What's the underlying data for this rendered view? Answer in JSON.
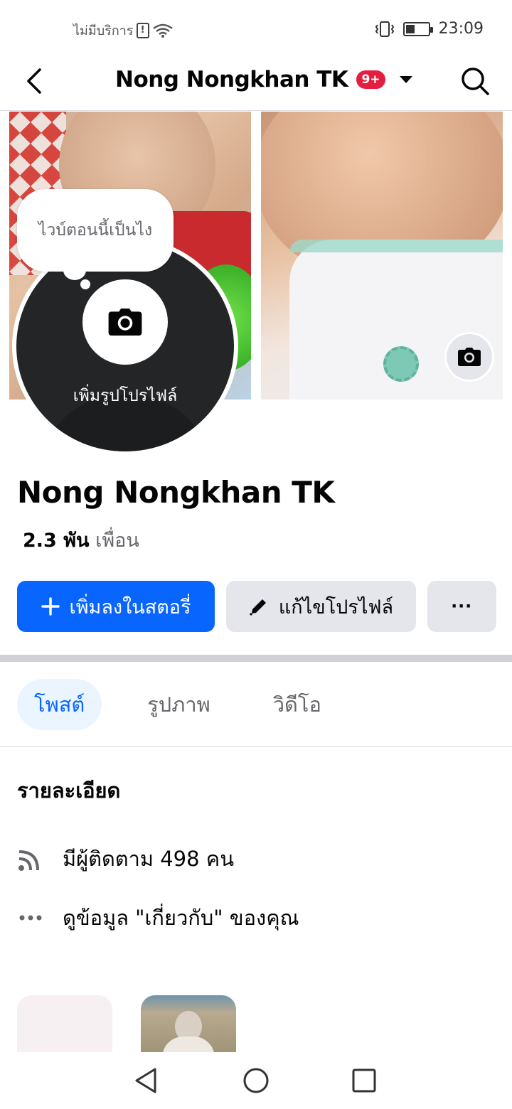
{
  "status_bar": {
    "carrier": "ไม่มีบริการ",
    "sim_icon": "sim-alert-icon",
    "wifi_icon": "wifi-icon",
    "vibrate_icon": "vibrate-icon",
    "battery_icon": "battery-icon",
    "battery_level": 0.4,
    "time": "23:09"
  },
  "header": {
    "back_icon": "back-arrow-icon",
    "title": "Nong Nongkhan TK",
    "notification_badge": "9+",
    "dropdown_icon": "caret-down-icon",
    "search_icon": "search-icon"
  },
  "cover": {
    "camera_icon": "camera-icon"
  },
  "avatar": {
    "bubble_text": "ไวบ์ตอนนี้เป็นไง",
    "add_label": "เพิ่มรูปโปรไฟล์",
    "camera_icon": "camera-icon"
  },
  "profile": {
    "name": "Nong Nongkhan TK",
    "friends_count": "2.3 พัน",
    "friends_label": "เพื่อน"
  },
  "actions": {
    "add_story": "เพิ่มลงในสตอรี่",
    "edit_profile": "แก้ไขโปรไฟล์",
    "more": "···"
  },
  "tabs": [
    {
      "label": "โพสต์",
      "active": true
    },
    {
      "label": "รูปภาพ",
      "active": false
    },
    {
      "label": "วิดีโอ",
      "active": false
    }
  ],
  "details": {
    "title": "รายละเอียด",
    "followers": "มีผู้ติดตาม 498 คน",
    "about": "ดูข้อมูล \"เกี่ยวกับ\" ของคุณ"
  },
  "colors": {
    "primary": "#0866ff",
    "secondary_bg": "#e4e6eb",
    "badge": "#e41e3f",
    "active_tab_bg": "#ebf5ff"
  }
}
